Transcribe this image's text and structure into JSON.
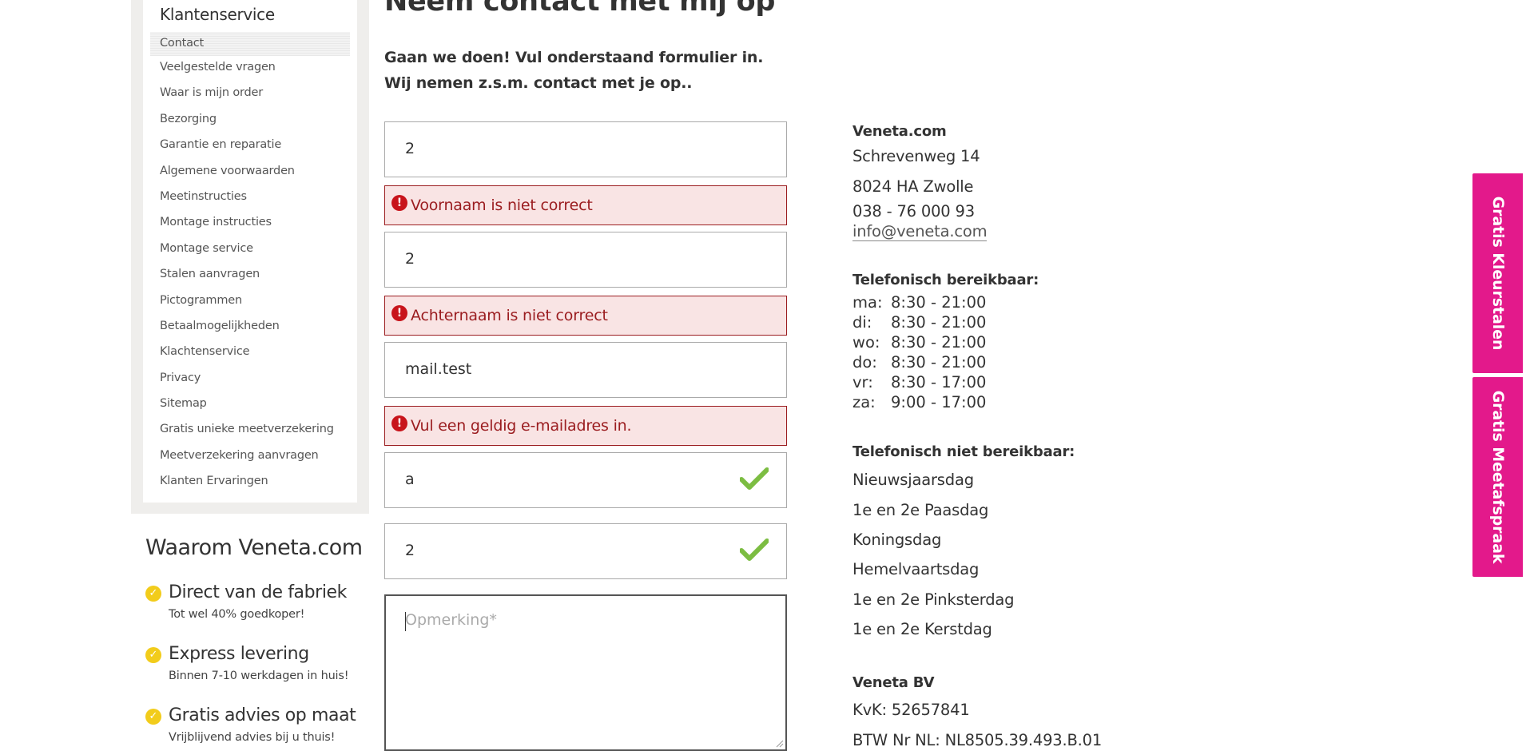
{
  "sidebar": {
    "title": "Klantenservice",
    "items": [
      {
        "label": "Contact"
      },
      {
        "label": "Veelgestelde vragen"
      },
      {
        "label": "Waar is mijn order"
      },
      {
        "label": "Bezorging"
      },
      {
        "label": "Garantie en reparatie"
      },
      {
        "label": "Algemene voorwaarden"
      },
      {
        "label": "Meetinstructies"
      },
      {
        "label": "Montage instructies"
      },
      {
        "label": "Montage service"
      },
      {
        "label": "Stalen aanvragen"
      },
      {
        "label": "Pictogrammen"
      },
      {
        "label": "Betaalmogelijkheden"
      },
      {
        "label": "Klachtenservice"
      },
      {
        "label": "Privacy"
      },
      {
        "label": "Sitemap"
      },
      {
        "label": "Gratis unieke meetverzekering"
      },
      {
        "label": "Meetverzekering aanvragen"
      },
      {
        "label": "Klanten Ervaringen"
      }
    ]
  },
  "why": {
    "title": "Waarom Veneta.com",
    "items": [
      {
        "heading": "Direct van de fabriek",
        "sub": "Tot wel 40% goedkoper!"
      },
      {
        "heading": "Express levering",
        "sub": "Binnen 7-10 werkdagen in huis!"
      },
      {
        "heading": "Gratis advies op maat",
        "sub": "Vrijblijvend advies bij u thuis!"
      }
    ]
  },
  "main": {
    "title": "Neem contact met mij op",
    "intro_line1": "Gaan we doen! Vul onderstaand formulier in.",
    "intro_line2": "Wij nemen z.s.m. contact met je op.."
  },
  "form": {
    "firstname_value": "2",
    "firstname_error": "Voornaam is niet correct",
    "lastname_value": "2",
    "lastname_error": "Achternaam is niet correct",
    "email_value": "mail.test",
    "email_error": "Vul een geldig e-mailadres in.",
    "field4_value": "a",
    "field5_value": "2",
    "remark_placeholder": "Opmerking*"
  },
  "contact": {
    "company": "Veneta.com",
    "street": "Schrevenweg 14",
    "city": "8024 HA Zwolle",
    "phone": "038 - 76 000 93",
    "email": "info@veneta.com",
    "reachable_title": "Telefonisch bereikbaar:",
    "hours": [
      {
        "day": "ma:",
        "time": "8:30 - 21:00"
      },
      {
        "day": "di:",
        "time": "8:30 - 21:00"
      },
      {
        "day": "wo:",
        "time": "8:30 - 21:00"
      },
      {
        "day": "do:",
        "time": "8:30 - 21:00"
      },
      {
        "day": "vr:",
        "time": "8:30 - 17:00"
      },
      {
        "day": "za:",
        "time": "9:00 - 17:00"
      }
    ],
    "unreachable_title": "Telefonisch niet bereikbaar:",
    "holidays": [
      "Nieuwsjaarsdag",
      "1e en 2e Paasdag",
      "Koningsdag",
      "Hemelvaartsdag",
      "1e en 2e Pinksterdag",
      "1e en 2e Kerstdag"
    ],
    "bv_title": "Veneta BV",
    "kvk": "KvK: 52657841",
    "btw": "BTW Nr NL: NL8505.39.493.B.01"
  },
  "tabs": {
    "colors_label": "Gratis Kleurstalen",
    "appointment_label": "Gratis Meetafspraak"
  },
  "colors": {
    "accent_pink": "#e3198b",
    "error_red": "#9b1d20",
    "check_green": "#7cbd42",
    "why_yellow": "#f2cc1b"
  }
}
